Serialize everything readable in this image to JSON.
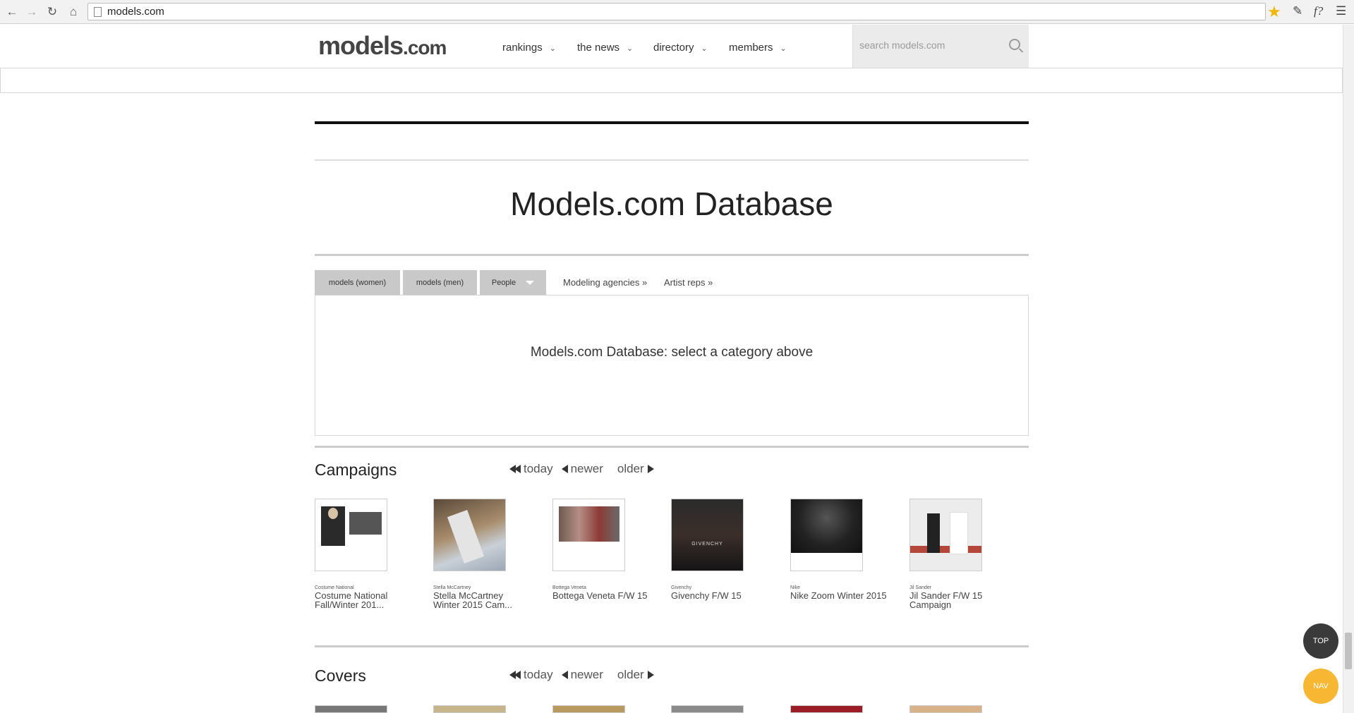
{
  "browser": {
    "url": "models.com",
    "back_icon": "arrow-left-icon",
    "forward_icon": "arrow-right-icon",
    "reload_icon": "reload-icon",
    "home_icon": "home-icon"
  },
  "header": {
    "logo_main": "models",
    "logo_suffix": ".com",
    "menu": [
      {
        "label": "rankings"
      },
      {
        "label": "the news"
      },
      {
        "label": "directory"
      },
      {
        "label": "members"
      }
    ],
    "search_placeholder": "search models.com"
  },
  "database": {
    "title": "Models.com Database",
    "tabs": [
      {
        "label": "models (women)"
      },
      {
        "label": "models (men)"
      },
      {
        "label": "People"
      }
    ],
    "links": [
      {
        "label": "Modeling agencies »"
      },
      {
        "label": "Artist reps »"
      }
    ],
    "message": "Models.com Database: select a category above"
  },
  "campaigns": {
    "title": "Campaigns",
    "pager": {
      "today": "today",
      "newer": "newer",
      "older": "older"
    },
    "items": [
      {
        "brand": "Costume National",
        "title": "Costume National Fall/Winter 201..."
      },
      {
        "brand": "Stella McCartney",
        "title": "Stella McCartney Winter 2015 Cam..."
      },
      {
        "brand": "Bottega Veneta",
        "title": "Bottega Veneta F/W 15"
      },
      {
        "brand": "Givenchy",
        "title": "Givenchy F/W 15",
        "thumb_text": "GIVENCHY"
      },
      {
        "brand": "Nike",
        "title": "Nike Zoom Winter 2015"
      },
      {
        "brand": "Jil Sander",
        "title": "Jil Sander F/W 15 Campaign"
      }
    ]
  },
  "covers": {
    "title": "Covers",
    "pager": {
      "today": "today",
      "newer": "newer",
      "older": "older"
    }
  },
  "float_buttons": {
    "top": "TOP",
    "nav": "NAV",
    "top_color": "#3a3a3a",
    "nav_color": "#f7b733"
  }
}
